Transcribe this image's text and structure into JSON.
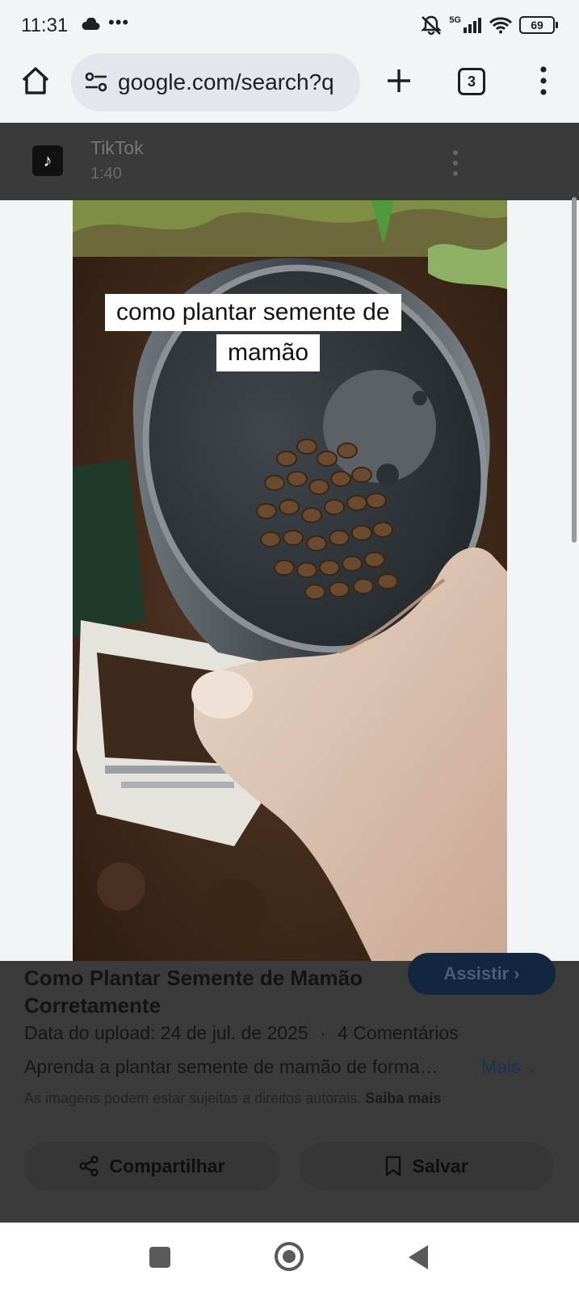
{
  "status_bar": {
    "time": "11:31",
    "more": "•••",
    "network": "5G",
    "battery": "69"
  },
  "toolbar": {
    "url": "google.com/search?q",
    "tab_count": "3"
  },
  "video": {
    "source": "TikTok",
    "duration": "1:40",
    "caption_line1": "como plantar semente de",
    "caption_line2": "mamão"
  },
  "result": {
    "title": "Como Plantar Semente de Mamão Corretamente",
    "watch_label": "Assistir",
    "upload": "Data do upload: 24 de jul. de 2025",
    "separator": "·",
    "comments": "4 Comentários",
    "description": "Aprenda a plantar semente de mamão de forma…",
    "more_label": "Mais",
    "copyright_note": "As imagens podem estar sujeitas a direitos autorais.",
    "learn_more": "Saiba mais",
    "share_label": "Compartilhar",
    "save_label": "Salvar"
  },
  "colors": {
    "accent_button": "#132640",
    "link": "#1b3252",
    "page_overlay": "#3b3b3b"
  }
}
